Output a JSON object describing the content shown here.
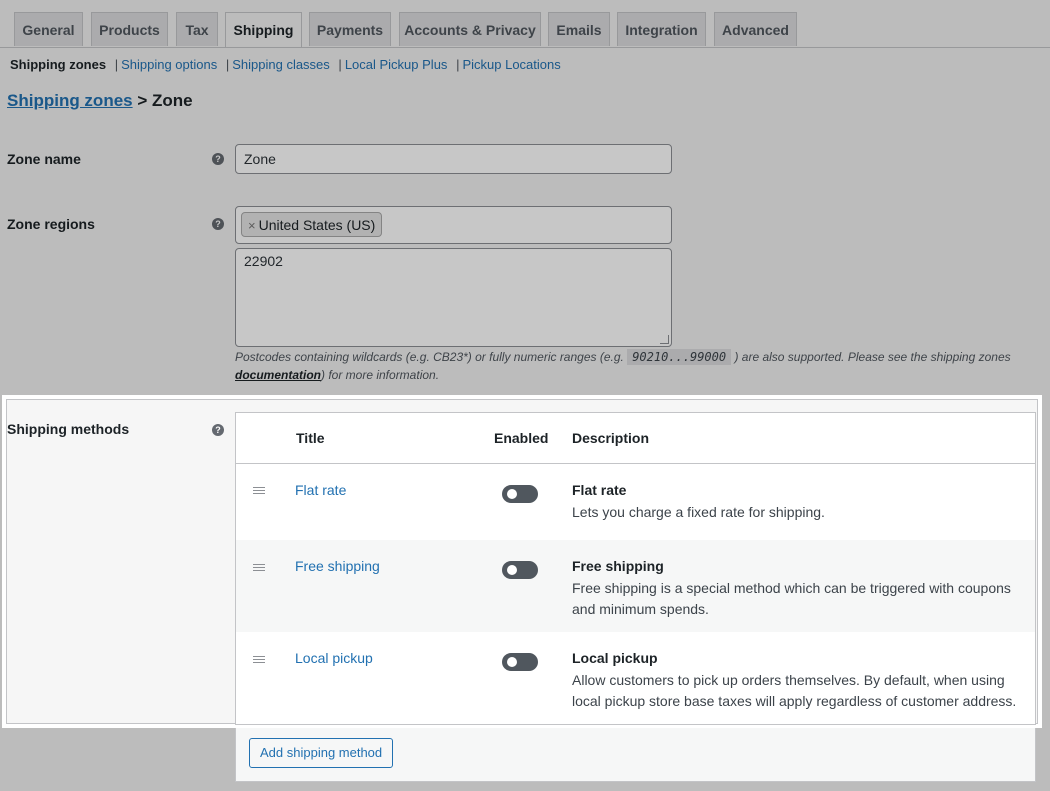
{
  "tabs": [
    "General",
    "Products",
    "Tax",
    "Shipping",
    "Payments",
    "Accounts & Privacy",
    "Emails",
    "Integration",
    "Advanced"
  ],
  "active_tab": "Shipping",
  "subnav": {
    "current": "Shipping zones",
    "links": [
      "Shipping options",
      "Shipping classes",
      "Local Pickup Plus",
      "Pickup Locations"
    ]
  },
  "breadcrumb": {
    "link": "Shipping zones",
    "rest": "> Zone"
  },
  "zone_name": {
    "label": "Zone name",
    "value": "Zone"
  },
  "zone_regions": {
    "label": "Zone regions",
    "chip": "United States (US)",
    "postcodes": "22902",
    "note_before": "Postcodes containing wildcards (e.g. CB23*) or fully numeric ranges (e.g. ",
    "note_code": "90210...99000",
    "note_after": ") are also supported. Please see the shipping zones",
    "note_link": "documentation",
    "note_end": ") for more information."
  },
  "shipping_methods": {
    "label": "Shipping methods",
    "headers": {
      "title": "Title",
      "enabled": "Enabled",
      "description": "Description"
    },
    "rows": [
      {
        "title": "Flat rate",
        "name": "Flat rate",
        "desc": "Lets you charge a fixed rate for shipping.",
        "enabled": false
      },
      {
        "title": "Free shipping",
        "name": "Free shipping",
        "desc": "Free shipping is a special method which can be triggered with coupons and minimum spends.",
        "enabled": false
      },
      {
        "title": "Local pickup",
        "name": "Local pickup",
        "desc": "Allow customers to pick up orders themselves. By default, when using local pickup store base taxes will apply regardless of customer address.",
        "enabled": false
      }
    ],
    "add_button": "Add shipping method"
  },
  "colors": {
    "link": "#2271b1",
    "background": "#f1f1f1"
  }
}
